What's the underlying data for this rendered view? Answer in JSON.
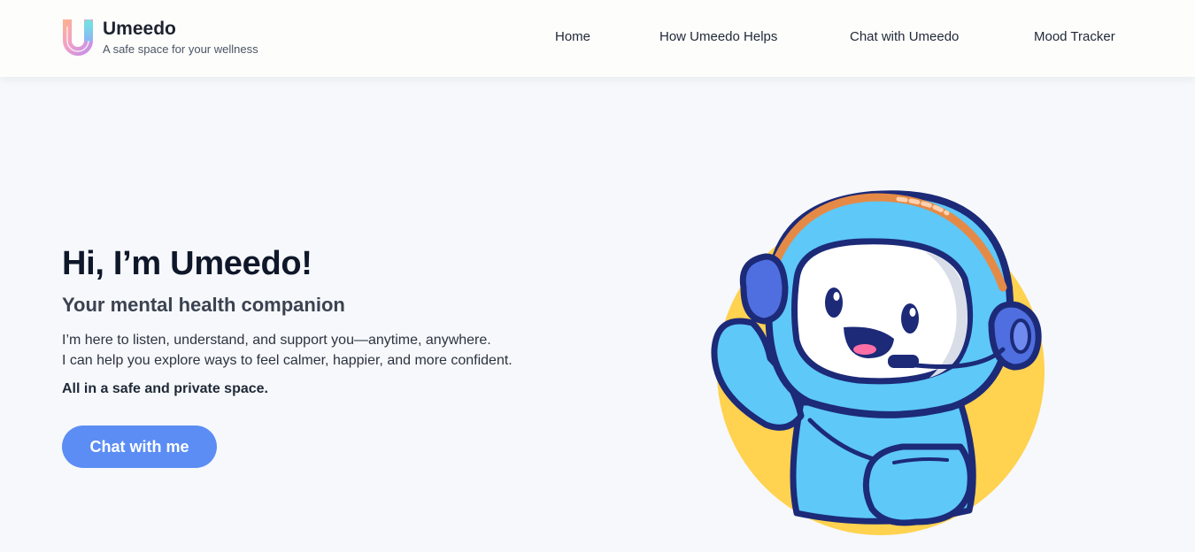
{
  "brand": {
    "name": "Umeedo",
    "tagline": "A safe space for your wellness",
    "logo_icon": "u-letter-gradient-logo"
  },
  "nav": {
    "items": [
      {
        "label": "Home"
      },
      {
        "label": "How Umeedo Helps"
      },
      {
        "label": "Chat with Umeedo"
      },
      {
        "label": "Mood Tracker"
      }
    ]
  },
  "hero": {
    "title": "Hi, I’m Umeedo!",
    "subtitle": "Your mental health companion",
    "line1": "I’m here to listen, understand, and support you—anytime, anywhere.",
    "line2": "I can help you explore ways to feel calmer, happier, and more confident.",
    "emphasis": "All in a safe and private space.",
    "cta_label": "Chat with me"
  },
  "illustration": {
    "icon": "robot-mascot-with-headset",
    "circle_color": "#ffd24f",
    "body_color": "#5ec8f8",
    "outline_color": "#1c2a78"
  },
  "colors": {
    "accent": "#5b8df4",
    "page_bg": "#f6f8fb",
    "header_bg": "#fdfdfc"
  }
}
